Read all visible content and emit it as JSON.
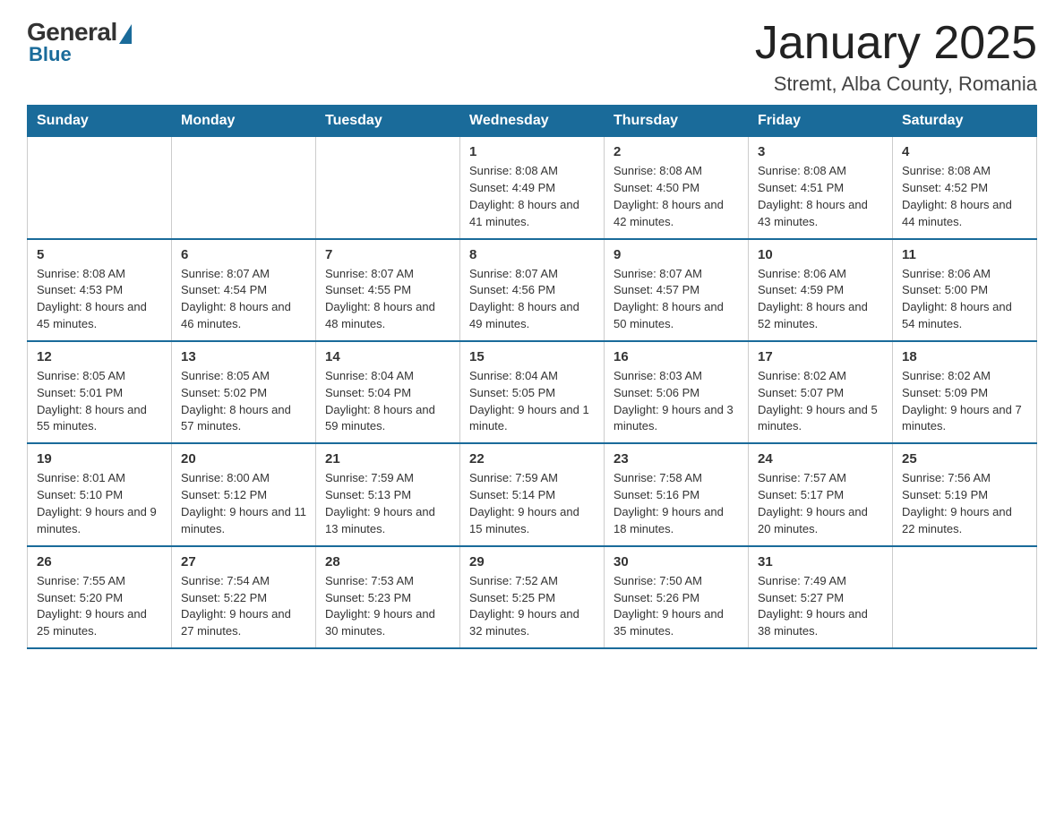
{
  "logo": {
    "general": "General",
    "blue": "Blue"
  },
  "header": {
    "month": "January 2025",
    "location": "Stremt, Alba County, Romania"
  },
  "days_of_week": [
    "Sunday",
    "Monday",
    "Tuesday",
    "Wednesday",
    "Thursday",
    "Friday",
    "Saturday"
  ],
  "weeks": [
    [
      {
        "day": "",
        "info": ""
      },
      {
        "day": "",
        "info": ""
      },
      {
        "day": "",
        "info": ""
      },
      {
        "day": "1",
        "info": "Sunrise: 8:08 AM\nSunset: 4:49 PM\nDaylight: 8 hours\nand 41 minutes."
      },
      {
        "day": "2",
        "info": "Sunrise: 8:08 AM\nSunset: 4:50 PM\nDaylight: 8 hours\nand 42 minutes."
      },
      {
        "day": "3",
        "info": "Sunrise: 8:08 AM\nSunset: 4:51 PM\nDaylight: 8 hours\nand 43 minutes."
      },
      {
        "day": "4",
        "info": "Sunrise: 8:08 AM\nSunset: 4:52 PM\nDaylight: 8 hours\nand 44 minutes."
      }
    ],
    [
      {
        "day": "5",
        "info": "Sunrise: 8:08 AM\nSunset: 4:53 PM\nDaylight: 8 hours\nand 45 minutes."
      },
      {
        "day": "6",
        "info": "Sunrise: 8:07 AM\nSunset: 4:54 PM\nDaylight: 8 hours\nand 46 minutes."
      },
      {
        "day": "7",
        "info": "Sunrise: 8:07 AM\nSunset: 4:55 PM\nDaylight: 8 hours\nand 48 minutes."
      },
      {
        "day": "8",
        "info": "Sunrise: 8:07 AM\nSunset: 4:56 PM\nDaylight: 8 hours\nand 49 minutes."
      },
      {
        "day": "9",
        "info": "Sunrise: 8:07 AM\nSunset: 4:57 PM\nDaylight: 8 hours\nand 50 minutes."
      },
      {
        "day": "10",
        "info": "Sunrise: 8:06 AM\nSunset: 4:59 PM\nDaylight: 8 hours\nand 52 minutes."
      },
      {
        "day": "11",
        "info": "Sunrise: 8:06 AM\nSunset: 5:00 PM\nDaylight: 8 hours\nand 54 minutes."
      }
    ],
    [
      {
        "day": "12",
        "info": "Sunrise: 8:05 AM\nSunset: 5:01 PM\nDaylight: 8 hours\nand 55 minutes."
      },
      {
        "day": "13",
        "info": "Sunrise: 8:05 AM\nSunset: 5:02 PM\nDaylight: 8 hours\nand 57 minutes."
      },
      {
        "day": "14",
        "info": "Sunrise: 8:04 AM\nSunset: 5:04 PM\nDaylight: 8 hours\nand 59 minutes."
      },
      {
        "day": "15",
        "info": "Sunrise: 8:04 AM\nSunset: 5:05 PM\nDaylight: 9 hours\nand 1 minute."
      },
      {
        "day": "16",
        "info": "Sunrise: 8:03 AM\nSunset: 5:06 PM\nDaylight: 9 hours\nand 3 minutes."
      },
      {
        "day": "17",
        "info": "Sunrise: 8:02 AM\nSunset: 5:07 PM\nDaylight: 9 hours\nand 5 minutes."
      },
      {
        "day": "18",
        "info": "Sunrise: 8:02 AM\nSunset: 5:09 PM\nDaylight: 9 hours\nand 7 minutes."
      }
    ],
    [
      {
        "day": "19",
        "info": "Sunrise: 8:01 AM\nSunset: 5:10 PM\nDaylight: 9 hours\nand 9 minutes."
      },
      {
        "day": "20",
        "info": "Sunrise: 8:00 AM\nSunset: 5:12 PM\nDaylight: 9 hours\nand 11 minutes."
      },
      {
        "day": "21",
        "info": "Sunrise: 7:59 AM\nSunset: 5:13 PM\nDaylight: 9 hours\nand 13 minutes."
      },
      {
        "day": "22",
        "info": "Sunrise: 7:59 AM\nSunset: 5:14 PM\nDaylight: 9 hours\nand 15 minutes."
      },
      {
        "day": "23",
        "info": "Sunrise: 7:58 AM\nSunset: 5:16 PM\nDaylight: 9 hours\nand 18 minutes."
      },
      {
        "day": "24",
        "info": "Sunrise: 7:57 AM\nSunset: 5:17 PM\nDaylight: 9 hours\nand 20 minutes."
      },
      {
        "day": "25",
        "info": "Sunrise: 7:56 AM\nSunset: 5:19 PM\nDaylight: 9 hours\nand 22 minutes."
      }
    ],
    [
      {
        "day": "26",
        "info": "Sunrise: 7:55 AM\nSunset: 5:20 PM\nDaylight: 9 hours\nand 25 minutes."
      },
      {
        "day": "27",
        "info": "Sunrise: 7:54 AM\nSunset: 5:22 PM\nDaylight: 9 hours\nand 27 minutes."
      },
      {
        "day": "28",
        "info": "Sunrise: 7:53 AM\nSunset: 5:23 PM\nDaylight: 9 hours\nand 30 minutes."
      },
      {
        "day": "29",
        "info": "Sunrise: 7:52 AM\nSunset: 5:25 PM\nDaylight: 9 hours\nand 32 minutes."
      },
      {
        "day": "30",
        "info": "Sunrise: 7:50 AM\nSunset: 5:26 PM\nDaylight: 9 hours\nand 35 minutes."
      },
      {
        "day": "31",
        "info": "Sunrise: 7:49 AM\nSunset: 5:27 PM\nDaylight: 9 hours\nand 38 minutes."
      },
      {
        "day": "",
        "info": ""
      }
    ]
  ]
}
